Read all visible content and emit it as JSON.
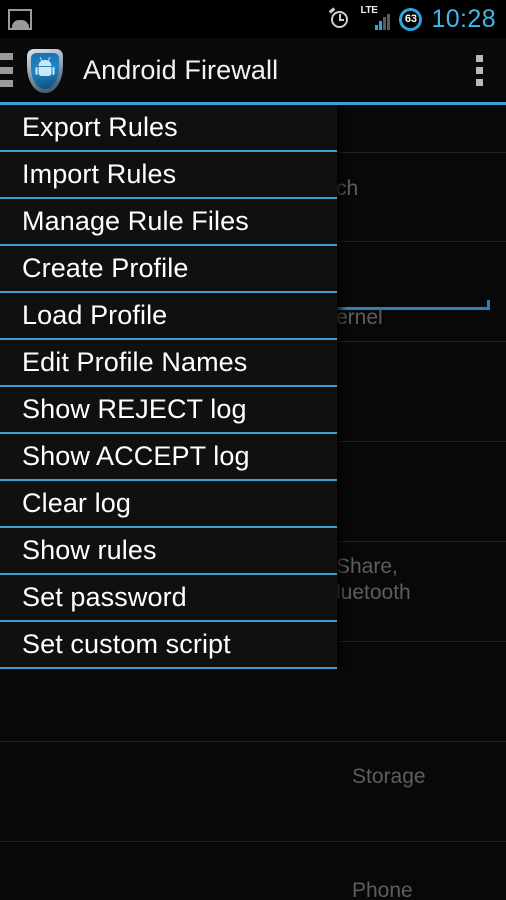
{
  "statusbar": {
    "gallery_icon": "image-icon",
    "alarm_icon": "alarm-clock-icon",
    "network_label": "LTE",
    "signal_icon": "signal-bars-icon",
    "battery_percent": "63",
    "time": "10:28"
  },
  "actionbar": {
    "drawer_icon": "hamburger-menu-icon",
    "app_icon": "android-firewall-shield-icon",
    "title": "Android Firewall",
    "overflow_icon": "overflow-menu-icon"
  },
  "menu": {
    "items": [
      {
        "label": "Export Rules"
      },
      {
        "label": "Import Rules"
      },
      {
        "label": "Manage Rule Files"
      },
      {
        "label": "Create Profile"
      },
      {
        "label": "Load Profile"
      },
      {
        "label": "Edit Profile Names"
      },
      {
        "label": "Show REJECT log"
      },
      {
        "label": "Show ACCEPT log"
      },
      {
        "label": "Clear log"
      },
      {
        "label": "Show rules"
      },
      {
        "label": "Set password"
      },
      {
        "label": "Set custom script"
      }
    ]
  },
  "backdrop": {
    "search_fragment": "ch",
    "kernel_fragment": "ernel",
    "share_fragment": "Share,\nluetooth",
    "storage_fragment": "Storage",
    "phone_fragment": "Phone"
  },
  "colors": {
    "accent": "#3d9fd6",
    "status_accent": "#3fb8ea",
    "menu_bg": "#101010",
    "screen_bg": "#000000",
    "text_primary": "#ffffff",
    "text_dim": "#5d5d5d"
  }
}
